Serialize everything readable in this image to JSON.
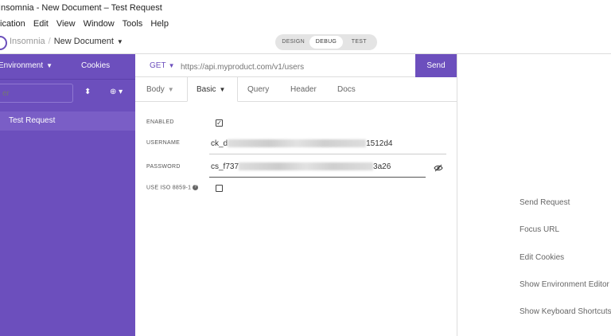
{
  "window": {
    "title": "Insomnia - New Document – Test Request"
  },
  "menu": {
    "items": [
      "ication",
      "Edit",
      "View",
      "Window",
      "Tools",
      "Help"
    ]
  },
  "header": {
    "workspace": "Insomnia",
    "separator": "/",
    "document": "New Document",
    "modes": [
      "DESIGN",
      "DEBUG",
      "TEST"
    ],
    "active_mode": "DEBUG"
  },
  "sidebar": {
    "environment_label": "Environment",
    "cookies_label": "Cookies",
    "filter_placeholder": "er",
    "requests": [
      {
        "name": "Test Request"
      }
    ],
    "bg_color": "#6c4fbd"
  },
  "request": {
    "method": "GET",
    "url_placeholder": "https://api.myproduct.com/v1/users",
    "send_label": "Send"
  },
  "tabs": [
    {
      "label": "Body",
      "has_dropdown": true
    },
    {
      "label": "Basic",
      "has_dropdown": true,
      "active": true
    },
    {
      "label": "Query"
    },
    {
      "label": "Header"
    },
    {
      "label": "Docs"
    }
  ],
  "auth": {
    "enabled_label": "ENABLED",
    "enabled": true,
    "username_label": "USERNAME",
    "username_prefix": "ck_d",
    "username_suffix": "1512d4",
    "password_label": "PASSWORD",
    "password_prefix": "cs_f737",
    "password_suffix": "3a26",
    "iso_label": "USE ISO 8859-1",
    "iso_enabled": false
  },
  "shortcuts": [
    "Send Request",
    "Focus URL",
    "Edit Cookies",
    "Show Environment Editor",
    "Show Keyboard Shortcuts"
  ],
  "colors": {
    "accent": "#6c4fbd"
  }
}
